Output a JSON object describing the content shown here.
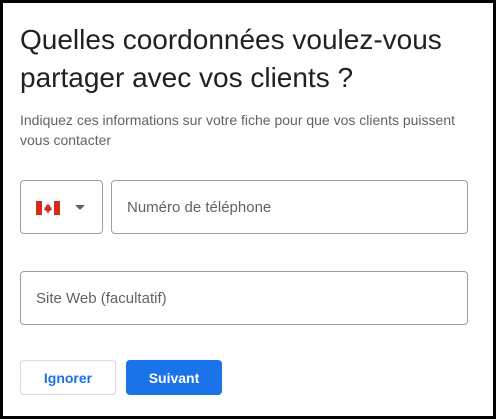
{
  "dialog": {
    "title": "Quelles coordonnées voulez-vous partager avec vos clients ?",
    "subtitle": "Indiquez ces informations sur votre fiche pour que vos clients puissent vous contacter"
  },
  "phone": {
    "country_flag_icon": "canada-flag-icon",
    "dropdown_icon": "caret-down-icon",
    "value": "",
    "placeholder": "Numéro de téléphone"
  },
  "website": {
    "value": "",
    "placeholder": "Site Web (facultatif)"
  },
  "actions": {
    "ignore_label": "Ignorer",
    "next_label": "Suivant"
  },
  "colors": {
    "primary": "#1a73e8",
    "title_text": "#202124",
    "secondary_text": "#5f6368",
    "border": "#9aa0a6",
    "flag_red": "#d52b1e"
  }
}
